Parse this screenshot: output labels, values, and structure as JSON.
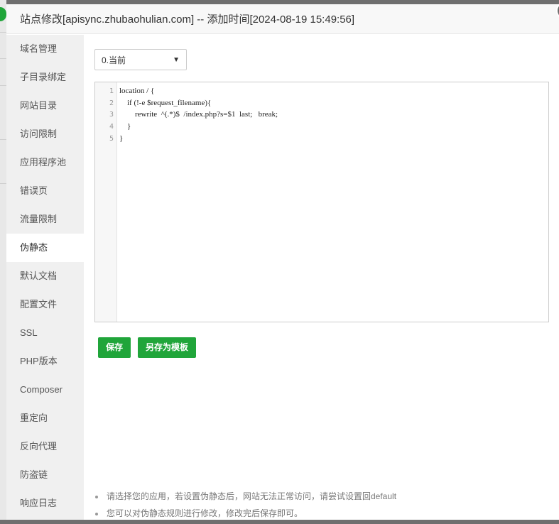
{
  "modal": {
    "title": "站点修改[apisync.zhubaohulian.com] -- 添加时间[2024-08-19 15:49:56]",
    "close_icon": "close-icon"
  },
  "sidebar": {
    "items": [
      {
        "label": "域名管理"
      },
      {
        "label": "子目录绑定"
      },
      {
        "label": "网站目录"
      },
      {
        "label": "访问限制"
      },
      {
        "label": "应用程序池"
      },
      {
        "label": "错误页"
      },
      {
        "label": "流量限制"
      },
      {
        "label": "伪静态",
        "active": true
      },
      {
        "label": "默认文档"
      },
      {
        "label": "配置文件"
      },
      {
        "label": "SSL"
      },
      {
        "label": "PHP版本"
      },
      {
        "label": "Composer"
      },
      {
        "label": "重定向"
      },
      {
        "label": "反向代理"
      },
      {
        "label": "防盗链"
      },
      {
        "label": "响应日志"
      }
    ]
  },
  "rewrite": {
    "template_select": {
      "selected": "0.当前"
    },
    "editor": {
      "line_numbers": [
        "1",
        "2",
        "3",
        "4",
        "5"
      ],
      "lines": [
        "location / {",
        "    if (!-e $request_filename){",
        "        rewrite  ^(.*)$  /index.php?s=$1  last;   break;",
        "    }",
        "}"
      ]
    },
    "buttons": {
      "save": "保存",
      "save_as_template": "另存为模板"
    },
    "tips": [
      "请选择您的应用，若设置伪静态后，网站无法正常访问，请尝试设置回default",
      "您可以对伪静态规则进行修改，修改完后保存即可。"
    ]
  },
  "colors": {
    "accent": "#20a53a",
    "sidebar_bg": "#f0f0f0",
    "header_bg": "#f8f8f8"
  }
}
